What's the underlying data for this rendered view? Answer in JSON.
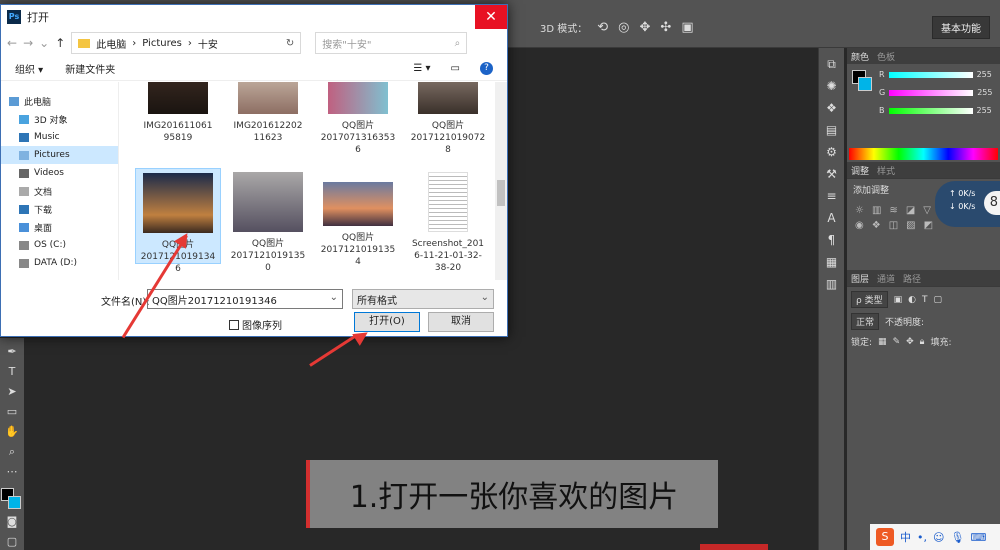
{
  "dialog": {
    "title": "打开",
    "close_glyph": "✕",
    "app_icon": "Ps",
    "breadcrumb": [
      "此电脑",
      "Pictures",
      "十安"
    ],
    "search_placeholder": "搜索\"十安\"",
    "organize": "组织 ▾",
    "new_folder": "新建文件夹",
    "nav_items": [
      {
        "label": "此电脑",
        "icon": "computer-icon"
      },
      {
        "label": "3D 对象",
        "icon": "3d-objects-icon"
      },
      {
        "label": "Music",
        "icon": "music-icon"
      },
      {
        "label": "Pictures",
        "icon": "pictures-icon"
      },
      {
        "label": "Videos",
        "icon": "videos-icon"
      },
      {
        "label": "文档",
        "icon": "documents-icon"
      },
      {
        "label": "下载",
        "icon": "download-icon"
      },
      {
        "label": "桌面",
        "icon": "desktop-icon"
      },
      {
        "label": "OS (C:)",
        "icon": "drive-icon"
      },
      {
        "label": "DATA (D:)",
        "icon": "drive-icon"
      }
    ],
    "files": [
      {
        "name": "IMG201611061\n95819"
      },
      {
        "name": "IMG201612202\n11623"
      },
      {
        "name": "QQ图片\n2017071316353\n6"
      },
      {
        "name": "QQ图片\n2017121019072\n8"
      },
      {
        "name": "QQ图片\n2017121019134\n6"
      },
      {
        "name": "QQ图片\n2017121019135\n0"
      },
      {
        "name": "QQ图片\n2017121019135\n4"
      },
      {
        "name": "Screenshot_201\n6-11-21-01-32-\n38-20"
      }
    ],
    "filename_label": "文件名(N):",
    "filename_value": "QQ图片20171210191346",
    "filetype": "所有格式",
    "image_sequence": "图像序列",
    "open_button": "打开(O)",
    "cancel_button": "取消"
  },
  "ps": {
    "mode_3d": "3D 模式：",
    "workspace": "基本功能",
    "panel_tabs_color": [
      "颜色",
      "色板"
    ],
    "rgb": [
      {
        "label": "R",
        "value": "255",
        "color": "#00d4ff"
      },
      {
        "label": "G",
        "value": "255",
        "color": "#3b82f6"
      },
      {
        "label": "B",
        "value": "255",
        "color": "#22c55e"
      }
    ],
    "panel_tabs_adj": [
      "调整",
      "样式"
    ],
    "adj_title": "添加调整",
    "panel_tabs_layers": [
      "图层",
      "通道",
      "路径"
    ],
    "layer_kind": "ρ 类型",
    "blend_mode": "正常",
    "opacity_label": "不透明度:",
    "lock_label": "锁定:",
    "fill_label": "填充:",
    "net_up": "0K/s",
    "net_down": "0K/s",
    "net_number": "8"
  },
  "caption": "1.打开一张你喜欢的图片",
  "tray": {
    "logo": "S",
    "ime": "中"
  }
}
